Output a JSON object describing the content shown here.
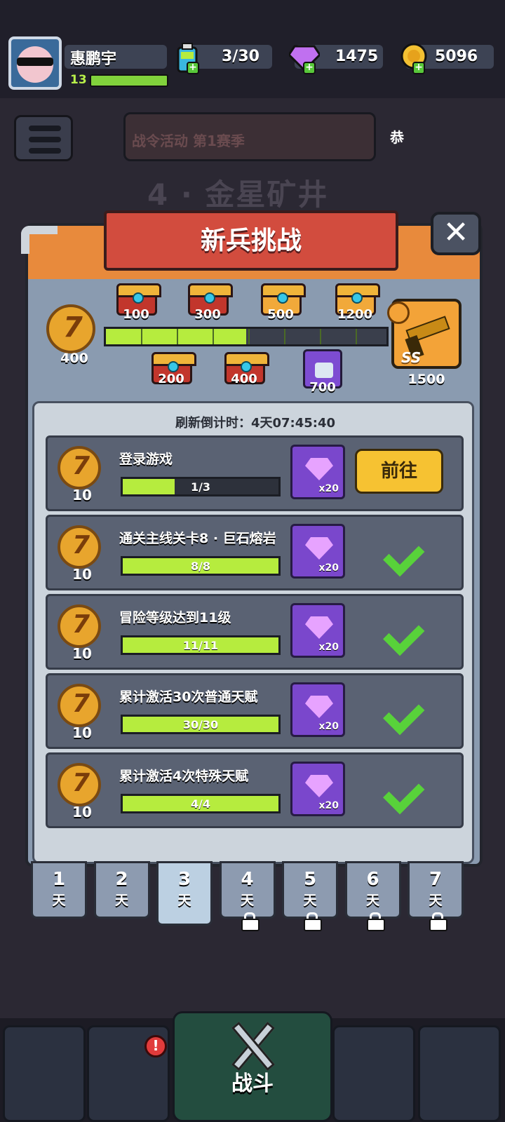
{
  "player": {
    "name": "惠鹏宇",
    "level": "13",
    "xp_progress": 1.0
  },
  "resources": {
    "energy": {
      "icon": "battery-icon",
      "value": "3/30"
    },
    "gems": {
      "icon": "gem-icon",
      "value": "1475"
    },
    "coins": {
      "icon": "coin-icon",
      "value": "5096"
    }
  },
  "background": {
    "banner": "战令活动  第1赛季",
    "banner_side": "恭",
    "stage_title": "4 · 金星矿井"
  },
  "modal": {
    "title": "新兵挑战",
    "close_label": "✕",
    "track": {
      "medal_value": "400",
      "progress_fraction": 0.5,
      "chests_top": [
        "100",
        "300",
        "500",
        "1200"
      ],
      "chests_bottom": [
        "200",
        "400"
      ],
      "shirt_reward": "700",
      "final_reward": {
        "value": "1500",
        "tag": "SS"
      }
    },
    "countdown": "刷新倒计时：4天07:45:40",
    "tasks": [
      {
        "medal": "10",
        "title": "登录游戏",
        "progress": "1/3",
        "fraction": 0.333,
        "reward_qty": "x20",
        "state": "go",
        "go_label": "前往"
      },
      {
        "medal": "10",
        "title": "通关主线关卡8 · 巨石熔岩",
        "progress": "8/8",
        "fraction": 1.0,
        "reward_qty": "x20",
        "state": "done"
      },
      {
        "medal": "10",
        "title": "冒险等级达到11级",
        "progress": "11/11",
        "fraction": 1.0,
        "reward_qty": "x20",
        "state": "done"
      },
      {
        "medal": "10",
        "title": "累计激活30次普通天赋",
        "progress": "30/30",
        "fraction": 1.0,
        "reward_qty": "x20",
        "state": "done"
      },
      {
        "medal": "10",
        "title": "累计激活4次特殊天赋",
        "progress": "4/4",
        "fraction": 1.0,
        "reward_qty": "x20",
        "state": "done"
      }
    ]
  },
  "days": [
    {
      "num": "1",
      "unit": "天",
      "locked": false
    },
    {
      "num": "2",
      "unit": "天",
      "locked": false
    },
    {
      "num": "3",
      "unit": "天",
      "locked": false,
      "active": true
    },
    {
      "num": "4",
      "unit": "天",
      "locked": true
    },
    {
      "num": "5",
      "unit": "天",
      "locked": true
    },
    {
      "num": "6",
      "unit": "天",
      "locked": true
    },
    {
      "num": "7",
      "unit": "天",
      "locked": true
    }
  ],
  "nav": {
    "battle_label": "战斗",
    "alert": "!"
  }
}
